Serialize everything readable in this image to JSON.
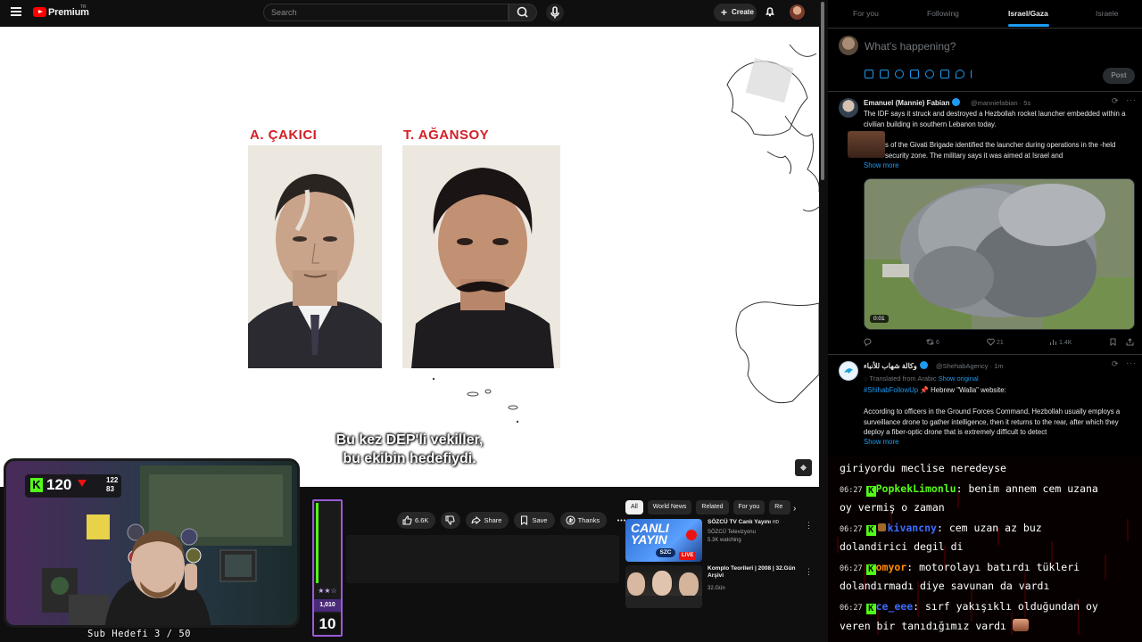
{
  "youtube": {
    "brand": "Premium",
    "region": "TR",
    "search_placeholder": "Search",
    "create_label": "Create",
    "video": {
      "label_left": "A. ÇAKICI",
      "label_right": "T. AĞANSOY",
      "subtitle_line1": "Bu kez DEP'li vekiller,",
      "subtitle_line2": "bu ekibin hedefiydi."
    },
    "actions": {
      "likes": "6.6K",
      "share": "Share",
      "save": "Save",
      "thanks": "Thanks"
    },
    "chips": [
      "All",
      "World News",
      "Related",
      "For you",
      "Re"
    ],
    "recommendations": [
      {
        "title": "SÖZCÜ TV Canlı Yayını",
        "hd": "HD",
        "channel": "SÖZCÜ Televizyonu",
        "meta": "5.3K watching",
        "thumb_text1": "CANLI",
        "thumb_text2": "YAYIN",
        "thumb_brand": "SZC",
        "thumb_live": "LIVE"
      },
      {
        "title": "Komplo Teorileri | 2008 | 32.Gün Arşivi",
        "channel": "32.Gün",
        "meta": ""
      }
    ]
  },
  "stream": {
    "kick_count": "120",
    "stat_top": "122",
    "stat_bottom": "83",
    "sub_goal": "Sub Hedefi 3 / 50",
    "goal_k": "1,010",
    "goal_num": "10",
    "goal_stars": "★★☆"
  },
  "twitter": {
    "tabs": [
      "For you",
      "Following",
      "Israel/Gaza",
      "Israele"
    ],
    "compose_placeholder": "What's happening?",
    "post_label": "Post",
    "tweets": [
      {
        "name": "Emanuel (Mannie) Fabian",
        "handle": "@manniefabian · 5s",
        "text1": "The IDF says it struck and destroyed a Hezbollah rocket launcher embedded within a civilian building in southern Lebanon today.",
        "text2": "s of the Givati Brigade identified the launcher during operations in the -held security zone. The military says it was aimed at Israel and",
        "show_more": "Show more",
        "duration": "0:01",
        "retweets": "6",
        "likes": "21",
        "views": "1.4K"
      },
      {
        "name": "وكالة شهاب للأنباء",
        "handle": "@ShehabAgency · 1m",
        "translated": "Translated from Arabic",
        "show_original": "Show original",
        "hashtag": "#ShihabFollowUp",
        "headline": "📌 Hebrew \"Walla\" website:",
        "text": "According to officers in the Ground Forces Command, Hezbollah usually employs a surveillance drone to gather intelligence, then it returns to the rear, after which they deploy a fiber-optic drone that is extremely difficult to detect",
        "show_more": "Show more"
      }
    ]
  },
  "chat": {
    "lines": [
      {
        "time": "",
        "user": "",
        "message": "giriyordu meclise neredeyse"
      },
      {
        "time": "06:27",
        "user": "PopkekLimonlu",
        "user_color": "#53fc18",
        "message": ": benim annem cem uzana"
      },
      {
        "time": "",
        "user": "",
        "message": "oy vermiş o zaman"
      },
      {
        "time": "06:27",
        "user": "kivancny",
        "user_color": "#3b6cff",
        "message": ": cem uzan az buz"
      },
      {
        "time": "",
        "user": "",
        "message": "dolandirici degil di"
      },
      {
        "time": "06:27",
        "user": "omyor",
        "user_color": "#ff8c00",
        "message": ": motorolayı batırdı tükleri"
      },
      {
        "time": "",
        "user": "",
        "message": "dolandırmadı diye savunan da vardı"
      },
      {
        "time": "06:27",
        "user": "ce_eee",
        "user_color": "#3b6cff",
        "message": ": sırf yakışıklı olduğundan oy"
      },
      {
        "time": "",
        "user": "",
        "message": "veren bir tanıdığımız vardı"
      }
    ]
  },
  "colors": {
    "kick_green": "#53fc18",
    "twitter_blue": "#1d9bf0",
    "youtube_red": "#ff0000",
    "label_red": "#d21f26"
  }
}
